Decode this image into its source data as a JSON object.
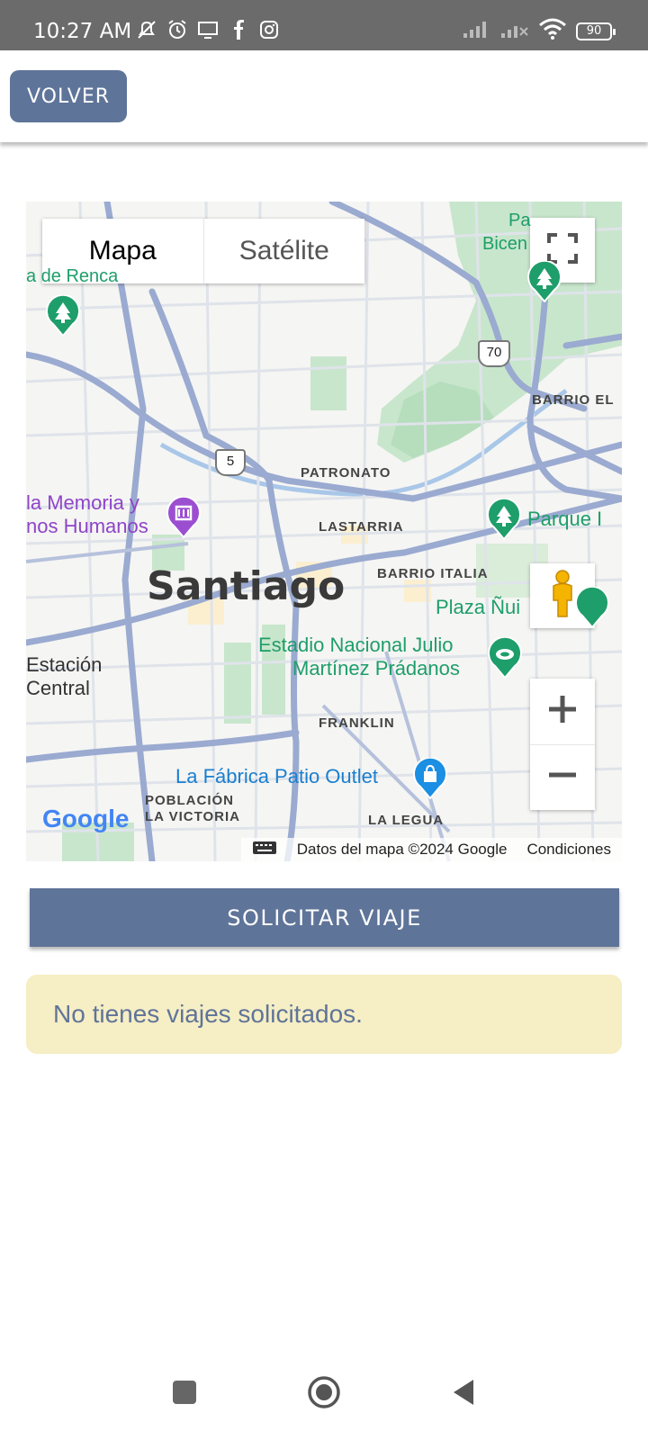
{
  "status_bar": {
    "time": "10:27 AM",
    "battery": "90",
    "icons": [
      "mute-icon",
      "alarm-icon",
      "screen-cast-icon",
      "facebook-icon",
      "instagram-icon",
      "signal-icon",
      "signal-off-icon",
      "wifi-icon",
      "battery-icon"
    ]
  },
  "header": {
    "back_label": "VOLVER"
  },
  "map": {
    "type_map": "Mapa",
    "type_satellite": "Satélite",
    "labels": {
      "santiago": "Santiago",
      "patronato": "PATRONATO",
      "lastarria": "LASTARRIA",
      "barrio_italia": "BARRIO ITALIA",
      "franklin": "FRANKLIN",
      "barrio_el": "BARRIO EL",
      "poblacion": "POBLACIÓN",
      "la_victoria": "LA VICTORIA",
      "la_legua": "LA LEGUA",
      "memoria_1": "la Memoria y",
      "memoria_2": "nos Humanos",
      "estacion_1": "Estación",
      "estacion_2": "Central",
      "estadio_1": "Estadio Nacional Julio",
      "estadio_2": "Martínez Prádanos",
      "fabrica": "La Fábrica Patio Outlet",
      "parque": "Parque I",
      "plaza": "Plaza Ñui",
      "renca": "a de Renca",
      "pa": "Pa",
      "bicen": "Bicen",
      "route5": "5",
      "route70": "70",
      "google": "Google"
    },
    "attribution": "Datos del mapa ©2024 Google",
    "terms": "Condiciones"
  },
  "actions": {
    "request_trip": "SOLICITAR VIAJE"
  },
  "notice": {
    "text": "No tienes viajes solicitados."
  },
  "colors": {
    "primary": "#5f7499",
    "notice_bg": "#f6eec4",
    "park_green": "#1e9e6a",
    "poi_purple": "#8e44c9"
  }
}
